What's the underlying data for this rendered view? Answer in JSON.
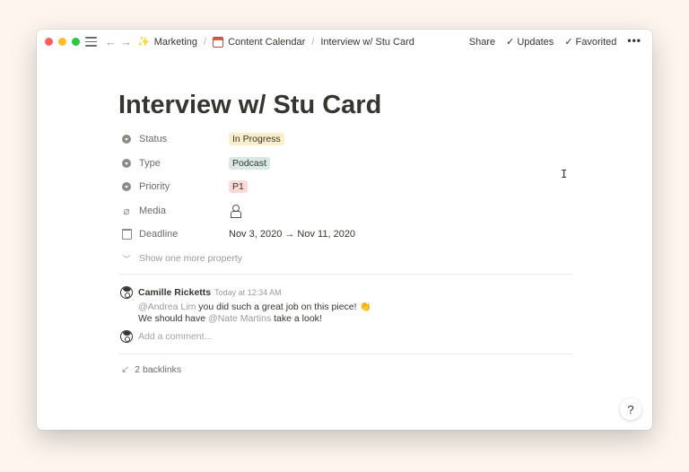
{
  "topbar": {
    "breadcrumbs": [
      {
        "icon": "sparkles-icon",
        "glyph": "✨",
        "label": "Marketing"
      },
      {
        "icon": "calendar-icon",
        "label": "Content Calendar"
      },
      {
        "label": "Interview w/ Stu Card"
      }
    ],
    "actions": {
      "share": "Share",
      "updates": "Updates",
      "favorited": "Favorited",
      "more": "•••"
    }
  },
  "page": {
    "title": "Interview w/ Stu Card",
    "properties": [
      {
        "label": "Status",
        "value": "In Progress"
      },
      {
        "label": "Type",
        "value": "Podcast"
      },
      {
        "label": "Priority",
        "value": "P1"
      },
      {
        "label": "Media"
      },
      {
        "label": "Deadline",
        "value": "Nov 3, 2020 → Nov 11, 2020"
      }
    ],
    "show_more": "Show one more property"
  },
  "comments": [
    {
      "author": "Camille Ricketts",
      "timestamp": "Today at 12:34 AM",
      "line1_mention": "@Andrea Lim",
      "line1_text": " you did such a great job on this piece! 👏",
      "line2_pre": "We should have ",
      "line2_mention": "@Nate Martins",
      "line2_post": " take a look!"
    }
  ],
  "add_comment_placeholder": "Add a comment...",
  "backlinks": "2 backlinks",
  "help": "?",
  "colors": {
    "status_bg": "#fbeecb",
    "type_bg": "#d9e8e2",
    "priority_bg": "#fbd9d7"
  }
}
